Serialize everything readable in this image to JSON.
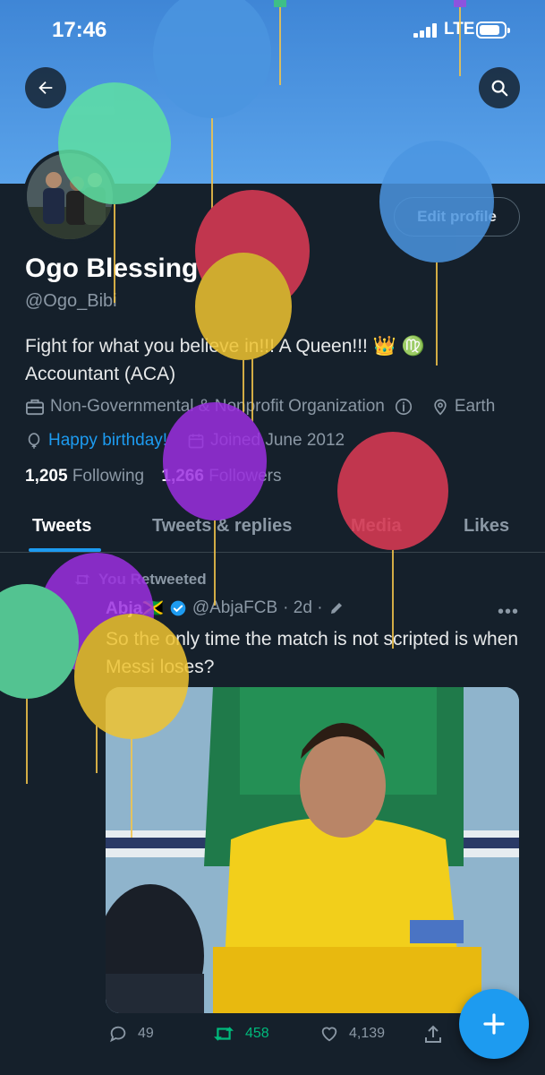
{
  "status_bar": {
    "time": "17:46",
    "network": "LTE"
  },
  "profile": {
    "name": "Ogo Blessing",
    "handle": "@Ogo_Bibi",
    "edit_label": "Edit profile",
    "bio_line1": "Fight for what you believe in!!! A Queen!!! 👑 ♍",
    "bio_line2": "Accountant (ACA)",
    "category": "Non-Governmental & Nonprofit Organization",
    "location": "Earth",
    "birthday": "Happy birthday!",
    "joined": "Joined June 2012",
    "following_count": "1,205",
    "following_label": "Following",
    "followers_count": "1,266",
    "followers_label": "Followers"
  },
  "tabs": [
    {
      "label": "Tweets",
      "active": true
    },
    {
      "label": "Tweets & replies",
      "active": false
    },
    {
      "label": "Media",
      "active": false
    },
    {
      "label": "Likes",
      "active": false
    }
  ],
  "tweet": {
    "retweet_label": "You Retweeted",
    "author": "Abja🇯🇲",
    "handle": "@AbjaFCB",
    "time": "· 2d ·",
    "text": "So the only time the match is not scripted is when Messi loses?",
    "actions": {
      "replies": "49",
      "retweets": "458",
      "likes": "4,139"
    }
  },
  "colors": {
    "accent": "#1d9bf0",
    "retweet_green": "#00ba7c",
    "background": "#15202b"
  }
}
